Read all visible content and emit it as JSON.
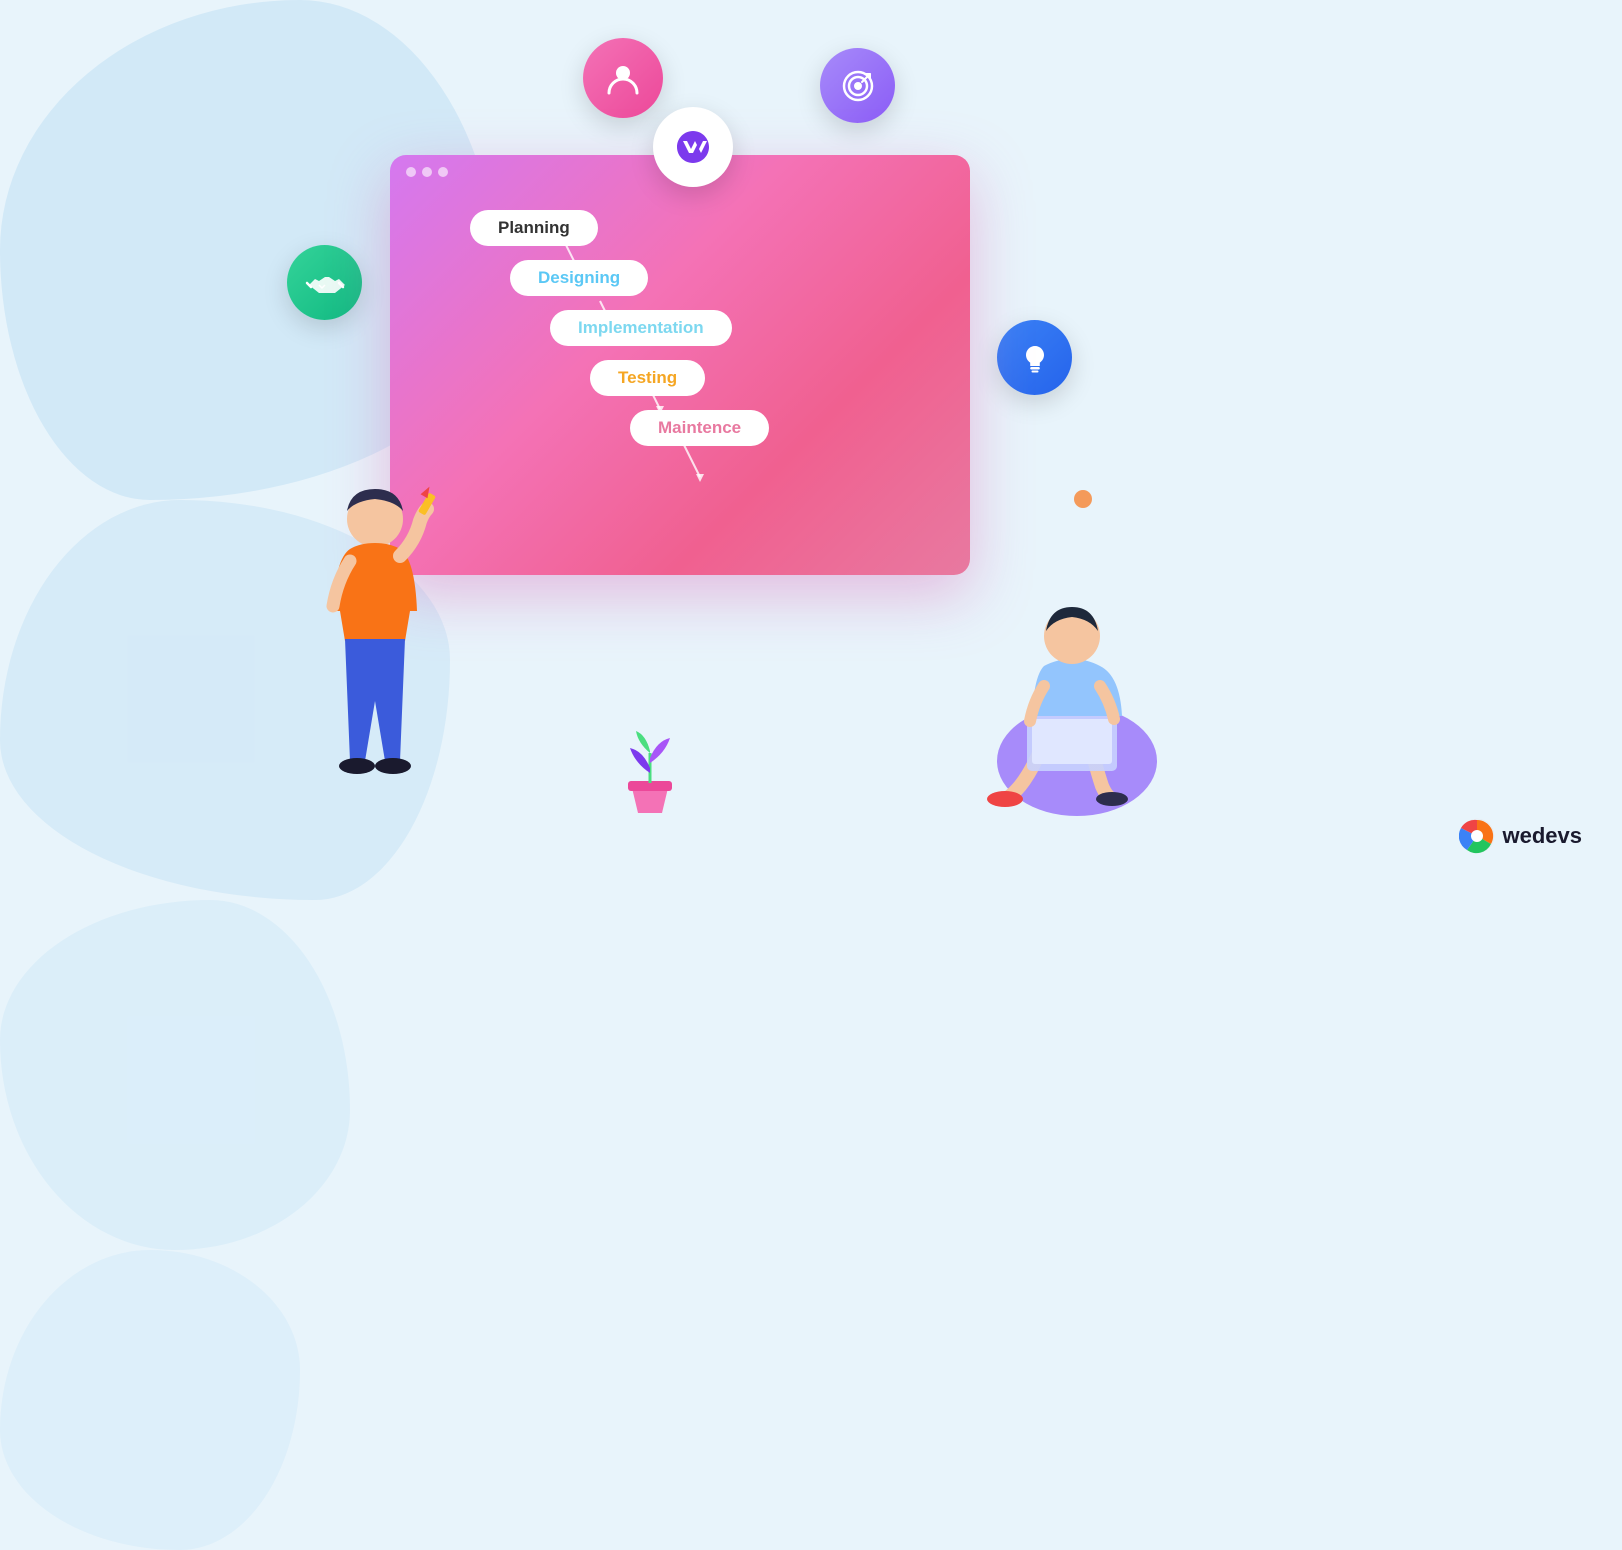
{
  "background": {
    "color": "#e8f4fb"
  },
  "browser": {
    "dots": [
      "dot1",
      "dot2",
      "dot3"
    ],
    "gradient_start": "#d478f0",
    "gradient_end": "#e879a0"
  },
  "flowchart": {
    "items": [
      {
        "id": "planning",
        "label": "Planning",
        "color": "#333333",
        "indent": 0
      },
      {
        "id": "designing",
        "label": "Designing",
        "color": "#5bc8f5",
        "indent": 40
      },
      {
        "id": "implementation",
        "label": "Implementation",
        "color": "#7dd8f0",
        "indent": 80
      },
      {
        "id": "testing",
        "label": "Testing",
        "color": "#f5a623",
        "indent": 120
      },
      {
        "id": "maintenance",
        "label": "Maintence",
        "color": "#e879a0",
        "indent": 160
      }
    ]
  },
  "logo": {
    "symbol": "⟨M⟩",
    "alt": "wedevs logo circle"
  },
  "floating_icons": [
    {
      "id": "user-icon",
      "symbol": "👤",
      "color_start": "#f472b6",
      "color_end": "#ec4899",
      "label": "User"
    },
    {
      "id": "target-icon",
      "symbol": "🎯",
      "color_start": "#a78bfa",
      "color_end": "#8b5cf6",
      "label": "Target"
    },
    {
      "id": "handshake-icon",
      "symbol": "🤝",
      "color_start": "#34d399",
      "color_end": "#10b981",
      "label": "Handshake"
    },
    {
      "id": "bulb-icon",
      "symbol": "💡",
      "color_start": "#3b82f6",
      "color_end": "#2563eb",
      "label": "Idea"
    }
  ],
  "branding": {
    "name": "wedevs",
    "tagline": ""
  }
}
